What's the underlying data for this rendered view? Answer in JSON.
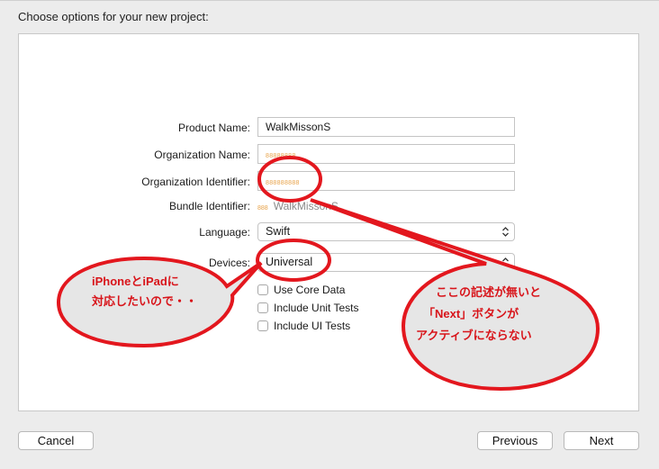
{
  "dialog": {
    "title": "Choose options for your new project:"
  },
  "form": {
    "product_name_label": "Product Name:",
    "product_name_value": "WalkMissonS",
    "org_name_label": "Organization Name:",
    "org_name_value": "88888888",
    "org_id_label": "Organization Identifier:",
    "org_id_value": "888888888",
    "bundle_label": "Bundle Identifier:",
    "bundle_prefix": "888",
    "bundle_value": "WalkMissonS",
    "language_label": "Language:",
    "language_value": "Swift",
    "devices_label": "Devices:",
    "devices_value": "Universal",
    "checkboxes": [
      {
        "label": "Use Core Data",
        "checked": false
      },
      {
        "label": "Include Unit Tests",
        "checked": false
      },
      {
        "label": "Include UI Tests",
        "checked": false
      }
    ]
  },
  "buttons": {
    "cancel": "Cancel",
    "previous": "Previous",
    "next": "Next"
  },
  "annotations": {
    "left_line1": "iPhoneとiPadに",
    "left_line2": "対応したいので・・",
    "right_line1": "ここの記述が無いと",
    "right_line2": "「Next」ボタンが",
    "right_line3": "アクティブにならない",
    "color": "#e3171e",
    "bubble_fill": "#e6e6e6"
  }
}
